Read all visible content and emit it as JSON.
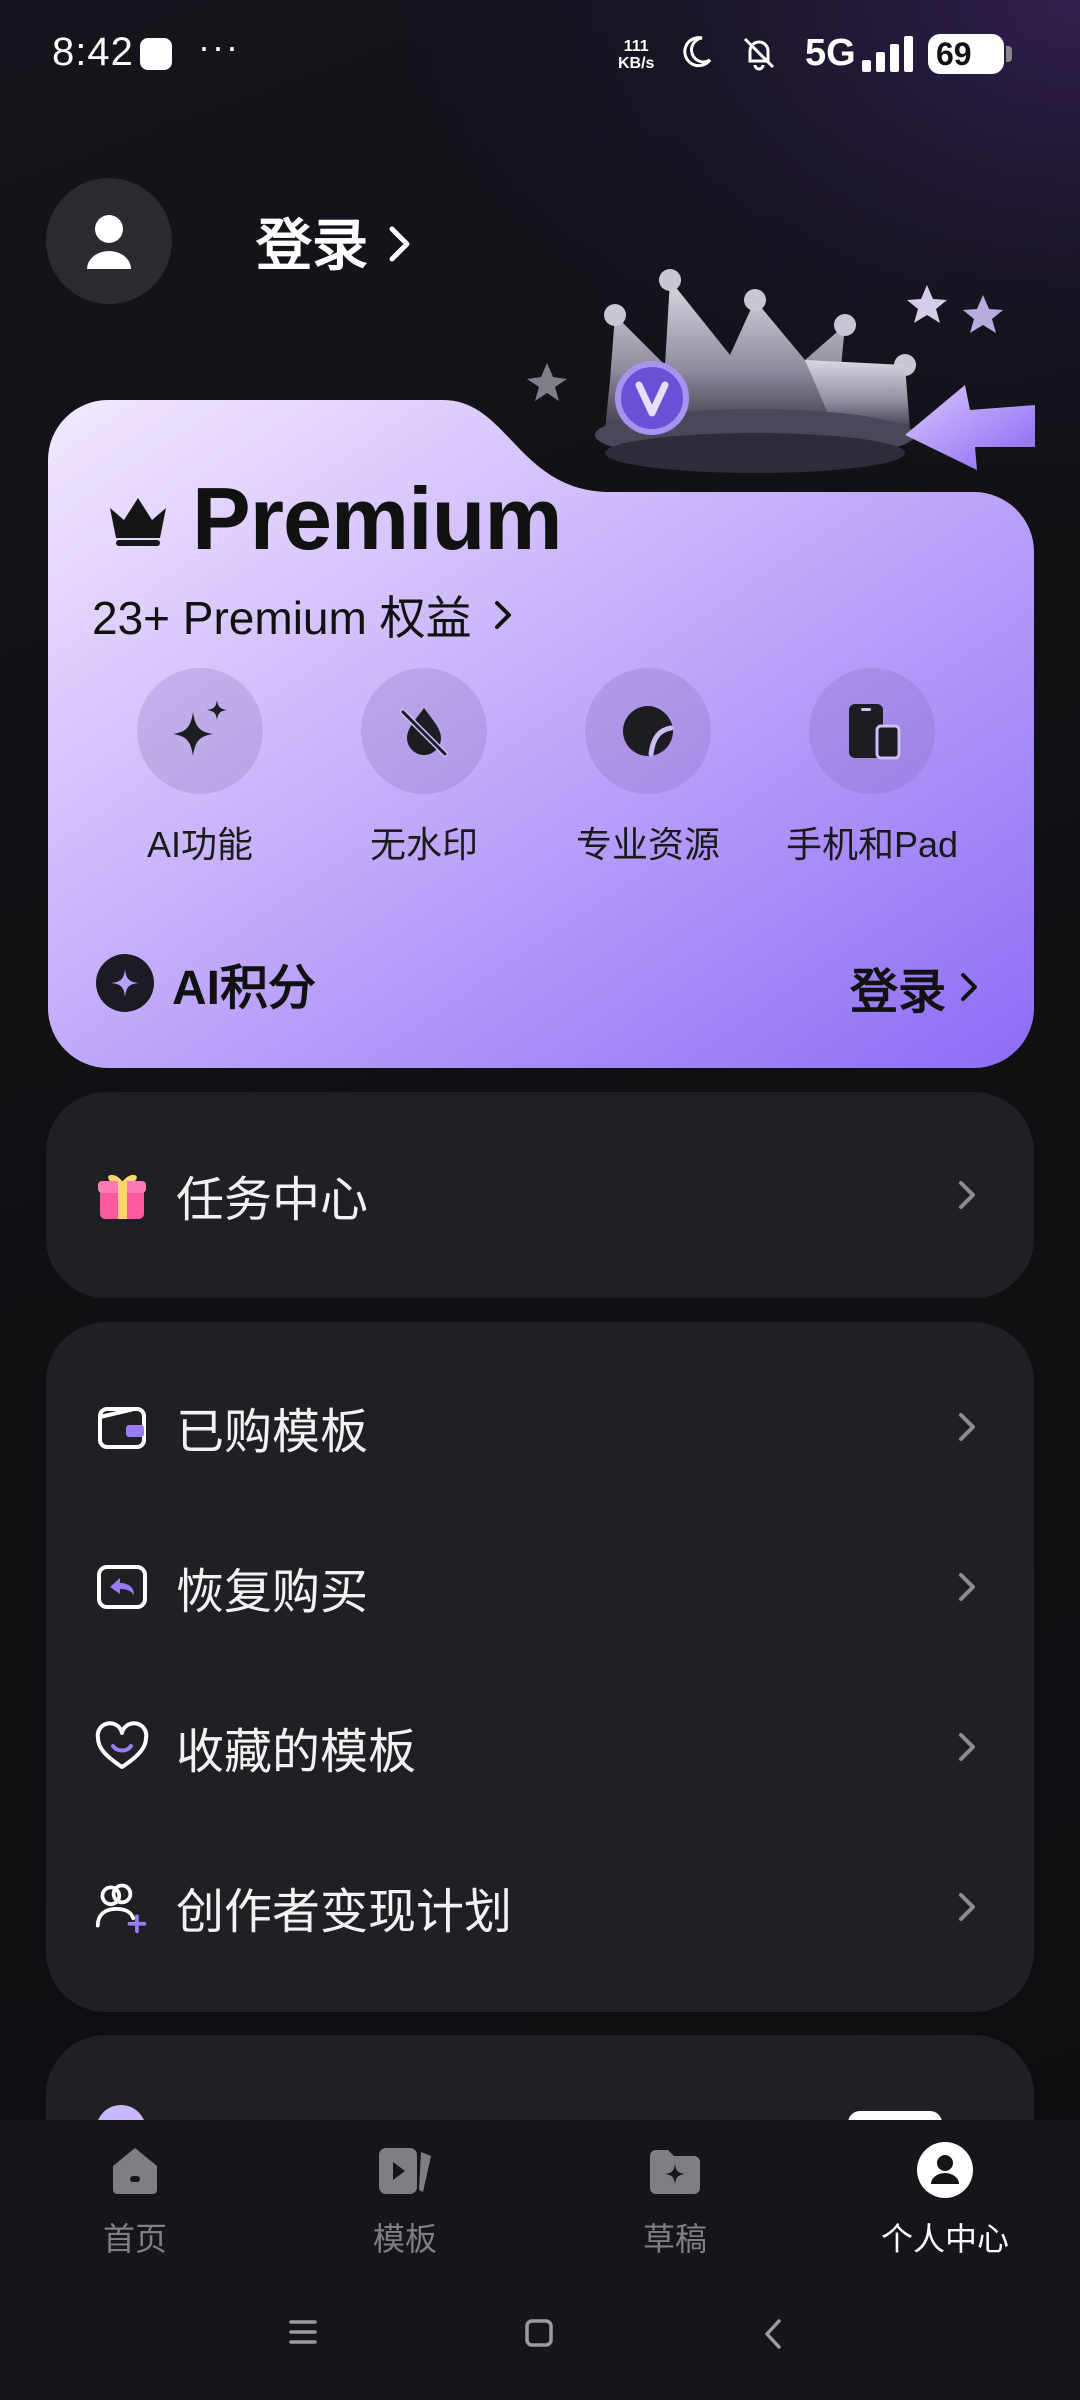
{
  "status_bar": {
    "time": "8:42",
    "dots": "···",
    "speed_value": "111",
    "speed_unit": "KB/s",
    "network": "5G",
    "battery": "69"
  },
  "header": {
    "login_label": "登录"
  },
  "premium": {
    "title": "Premium",
    "benefits_text": "23+ Premium 权益",
    "features": [
      {
        "label": "AI功能",
        "icon": "sparkle-icon"
      },
      {
        "label": "无水印",
        "icon": "no-watermark-icon"
      },
      {
        "label": "专业资源",
        "icon": "pro-resource-icon"
      },
      {
        "label": "手机和Pad",
        "icon": "devices-icon"
      }
    ],
    "points_label": "AI积分",
    "points_login": "登录"
  },
  "menu": {
    "task_center": "任务中心",
    "items": [
      {
        "label": "已购模板",
        "icon": "wallet-icon"
      },
      {
        "label": "恢复购买",
        "icon": "restore-icon"
      },
      {
        "label": "收藏的模板",
        "icon": "heart-icon"
      },
      {
        "label": "创作者变现计划",
        "icon": "creator-icon"
      }
    ]
  },
  "bottom_nav": {
    "items": [
      {
        "label": "首页",
        "icon": "home-icon"
      },
      {
        "label": "模板",
        "icon": "template-icon"
      },
      {
        "label": "草稿",
        "icon": "drafts-icon"
      },
      {
        "label": "个人中心",
        "icon": "profile-icon"
      }
    ],
    "active_index": 3
  },
  "colors": {
    "background": "#111114",
    "card": "#1f2024",
    "premium_light": "#f1e6ff",
    "premium_dark": "#8f6ff5",
    "accent": "#9b7cf7"
  }
}
